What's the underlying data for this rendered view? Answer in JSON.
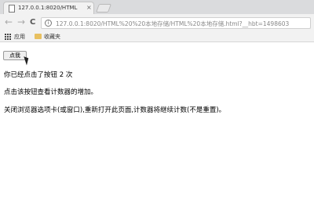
{
  "browser": {
    "tab_title": "127.0.0.1:8020/HTML",
    "tab_close": "×",
    "nav": {
      "back": "←",
      "forward": "→",
      "reload": "C"
    },
    "url_info": "i",
    "url": "127.0.0.1:8020/HTML%20%20本地存储/HTML%20本地存储.html?__hbt=1498603",
    "bookmarks": [
      {
        "label": "应用"
      },
      {
        "label": "收藏夹"
      }
    ]
  },
  "page": {
    "button_label": "点我",
    "click_count_text": "你已经点击了按钮 2 次",
    "hint_text": "点击该按钮查看计数器的增加。",
    "note_text": "关闭浏览器选项卡(或窗口),重新打开此页面,计数器将继续计数(不是重置)。"
  }
}
